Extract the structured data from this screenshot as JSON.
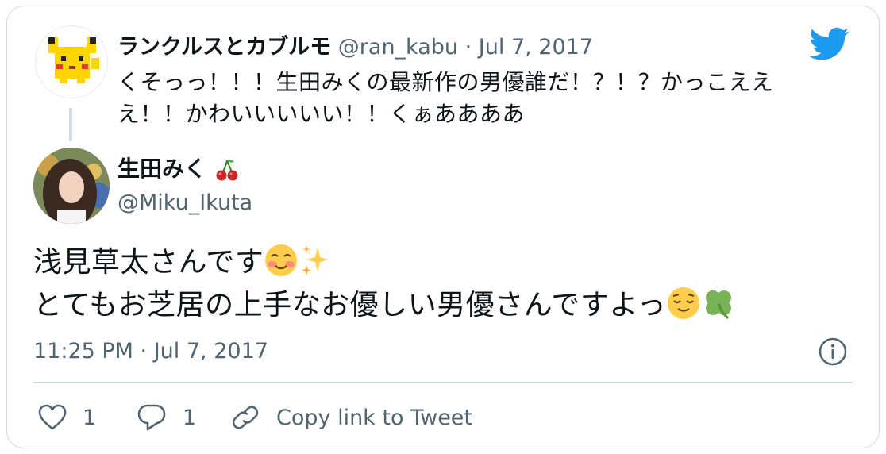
{
  "reply_tweet": {
    "author_name": "ランクルスとカブルモ",
    "handle": "@ran_kabu",
    "date": "Jul 7, 2017",
    "text": "くそっっ！！！生田みくの最新作の男優誰だ！？！？かっこえええ！！かわいいいいい！！くぁああああ"
  },
  "tweet": {
    "author_name": "生田みく",
    "handle": "@Miku_Ikuta",
    "line1": "浅見草太さんです",
    "line2": "とてもお芝居の上手なお優しい男優さんですよっ",
    "timestamp": "11:25 PM · Jul 7, 2017"
  },
  "actions": {
    "like_count": "1",
    "reply_count": "1",
    "copy_label": "Copy link to Tweet"
  },
  "icons": [
    "twitter-bird-icon",
    "cherry-icon",
    "smiling-blush-emoji",
    "sparkles-emoji",
    "relieved-face-emoji",
    "four-leaf-clover-emoji",
    "info-icon",
    "heart-icon",
    "reply-icon",
    "link-icon"
  ],
  "colors": {
    "brand": "#1d9bf0",
    "secondary_text": "#536471",
    "border": "#cfd9de"
  }
}
